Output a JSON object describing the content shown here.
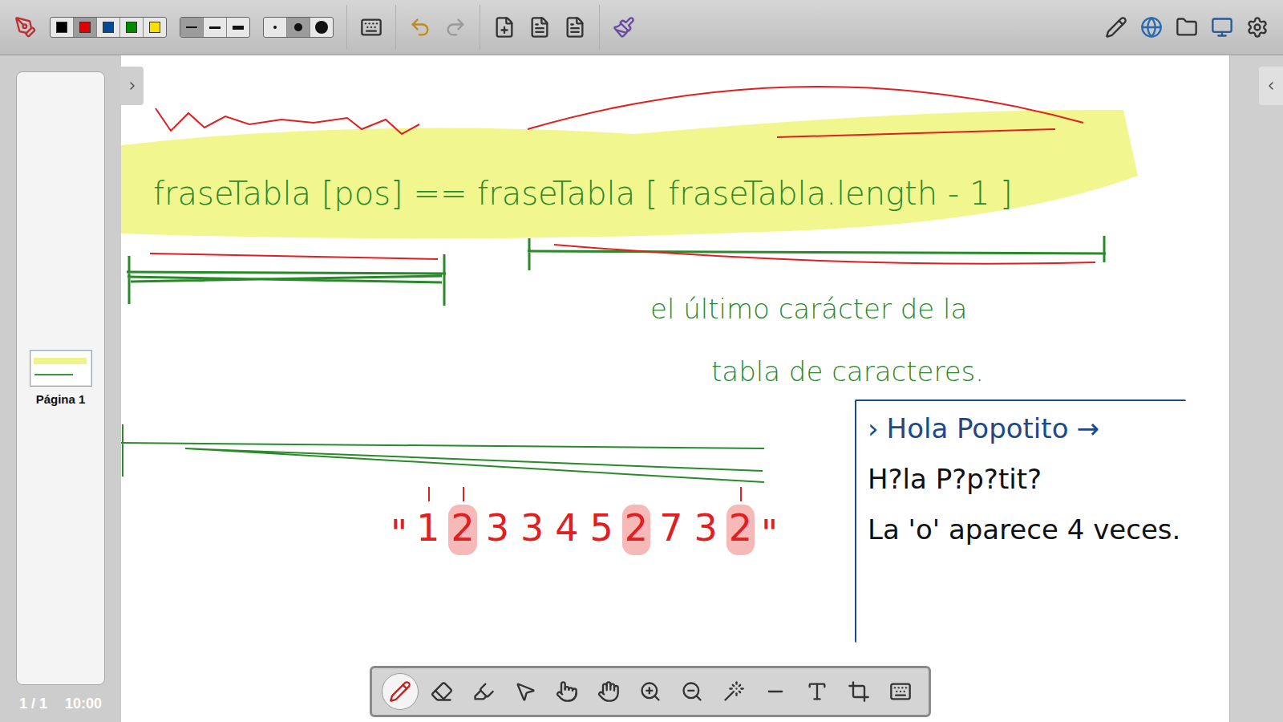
{
  "toolbar": {
    "colors": [
      {
        "color": "#000000",
        "selected": false
      },
      {
        "color": "#e00000",
        "selected": true
      },
      {
        "color": "#004a99",
        "selected": false
      },
      {
        "color": "#008a00",
        "selected": false
      },
      {
        "color": "#f5e000",
        "selected": false
      }
    ],
    "line_widths": [
      {
        "width": 1,
        "selected": true
      },
      {
        "width": 2,
        "selected": false
      },
      {
        "width": 4,
        "selected": false
      }
    ],
    "eraser_sizes": [
      {
        "size": 3,
        "selected": false
      },
      {
        "size": 6,
        "selected": true
      },
      {
        "size": 10,
        "selected": false
      }
    ]
  },
  "pages_panel": {
    "thumbnails": [
      {
        "label": "Página 1",
        "selected": true
      }
    ],
    "page_count": "1 / 1",
    "time": "10:00"
  },
  "canvas": {
    "formula": "fraseTabla [pos] == fraseTabla [ fraseTabla.length - 1 ]",
    "note_lines": [
      "el último carácter de la",
      "tabla de caracteres."
    ],
    "sequence": {
      "open_quote": "\"",
      "close_quote": "\"",
      "digits": [
        {
          "char": "1",
          "marked": false,
          "ticked": true
        },
        {
          "char": "2",
          "marked": true,
          "ticked": true
        },
        {
          "char": "3",
          "marked": false,
          "ticked": false
        },
        {
          "char": "3",
          "marked": false,
          "ticked": false
        },
        {
          "char": "4",
          "marked": false,
          "ticked": false
        },
        {
          "char": "5",
          "marked": false,
          "ticked": false
        },
        {
          "char": "2",
          "marked": true,
          "ticked": false
        },
        {
          "char": "7",
          "marked": false,
          "ticked": false
        },
        {
          "char": "3",
          "marked": false,
          "ticked": false
        },
        {
          "char": "2",
          "marked": true,
          "ticked": true
        }
      ]
    },
    "console_box": {
      "prompt": "›",
      "input": "Hola Popotito",
      "arrow": "→",
      "output": "H?la P?p?tit?",
      "result": "La 'o' aparece 4 veces."
    }
  },
  "tools": [
    {
      "tool": "pen",
      "selected": true
    },
    {
      "tool": "eraser",
      "selected": false
    },
    {
      "tool": "marker",
      "selected": false
    },
    {
      "tool": "selector",
      "selected": false
    },
    {
      "tool": "play",
      "selected": false
    },
    {
      "tool": "hand",
      "selected": false
    },
    {
      "tool": "zoom-in",
      "selected": false
    },
    {
      "tool": "zoom-out",
      "selected": false
    },
    {
      "tool": "laser",
      "selected": false
    },
    {
      "tool": "line",
      "selected": false
    },
    {
      "tool": "text",
      "selected": false
    },
    {
      "tool": "capture",
      "selected": false
    },
    {
      "tool": "keyboard",
      "selected": false
    }
  ]
}
